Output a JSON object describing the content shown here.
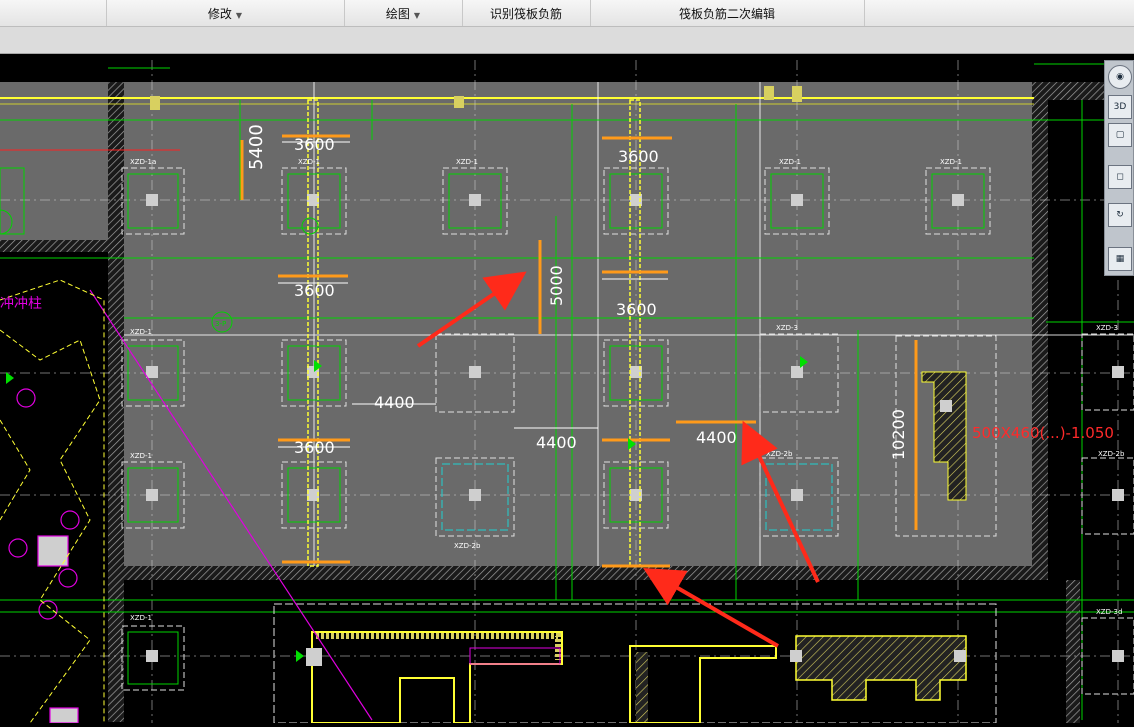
{
  "ribbon": {
    "modify_label": "修改",
    "draw_label": "绘图",
    "recognize_label": "识别筏板负筋",
    "secondary_edit_label": "筏板负筋二次编辑"
  },
  "drawing": {
    "dimensions": [
      "5400",
      "3600",
      "3600",
      "3600",
      "5000",
      "3600",
      "4400",
      "4400",
      "4400",
      "3600",
      "10200"
    ],
    "column_tags": [
      "XZD-1a",
      "XZD-1",
      "XZD-1",
      "XZD-1",
      "XZD-1",
      "XZD-1",
      "XZD-1",
      "XZD-2b",
      "XZD-2b",
      "XZD-3",
      "XZD-3",
      "XZD-1",
      "XZD-2b",
      "XZD-3d"
    ],
    "red_note": "500X460(...)-1.050",
    "axis_bubble": "3-P"
  },
  "viewcube": {
    "label_3d": "3D"
  },
  "colors": {
    "background": "#000000",
    "slab": "#6a6a6a",
    "hatch": "#a0a0a0",
    "grid": "#ffffff",
    "green": "#00d400",
    "yellow": "#ffff33",
    "orange": "#ff9a1a",
    "magenta": "#e000e0",
    "red_arrow": "#ff2a1a",
    "cyan": "#20d0d0"
  }
}
